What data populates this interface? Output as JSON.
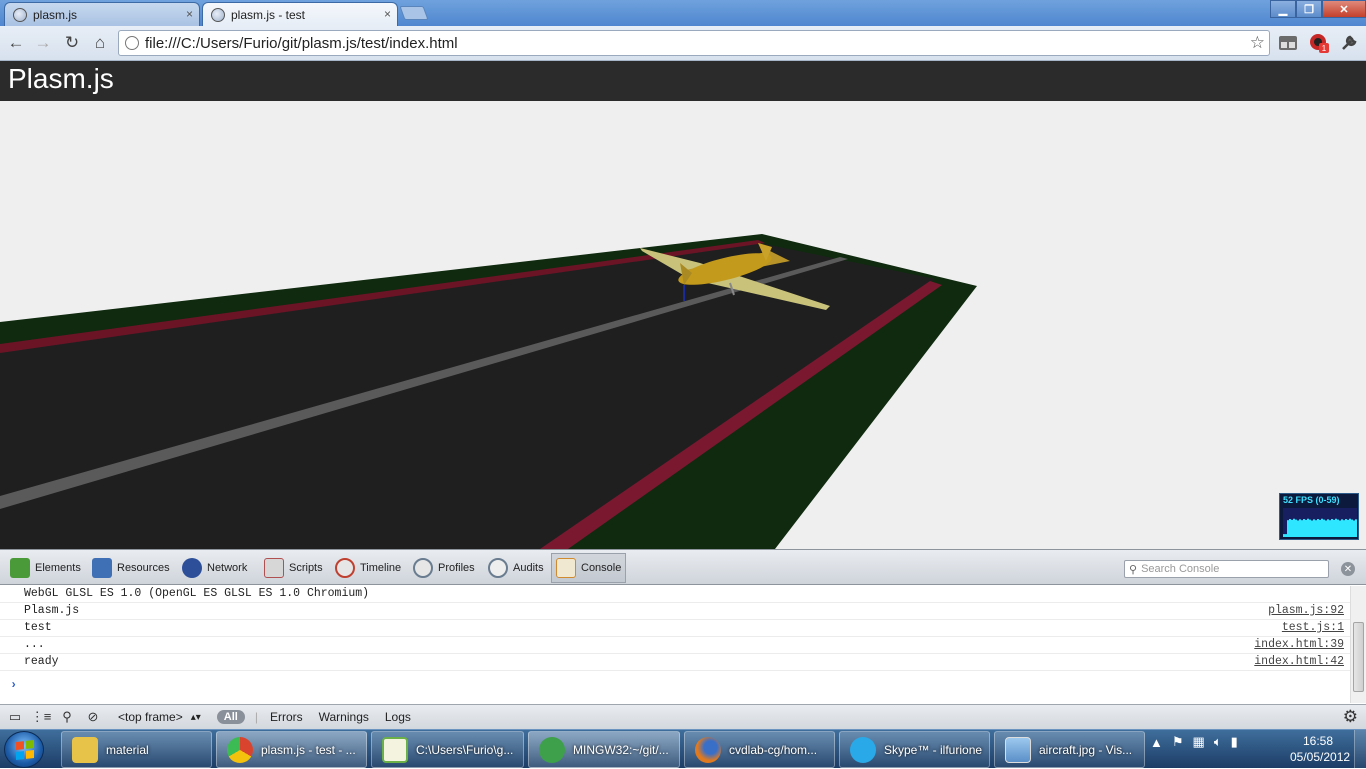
{
  "browser": {
    "tabs": [
      {
        "title": "plasm.js",
        "active": false
      },
      {
        "title": "plasm.js - test",
        "active": true
      }
    ],
    "tab_close_glyph": "×",
    "new_tab_icon": "new-tab-icon",
    "window_controls": {
      "minimize": "▁",
      "maximize": "❐",
      "close": "✕"
    },
    "nav": {
      "back": "←",
      "forward": "→",
      "reload": "↻",
      "home": "⌂"
    },
    "url": "file:///C:/Users/Furio/git/plasm.js/test/index.html",
    "star_glyph": "☆",
    "extension_badge": "1"
  },
  "page": {
    "title": "Plasm.js",
    "fps_label": "52 FPS (0-59)",
    "fps_level": 0.6
  },
  "devtools": {
    "tabs": [
      {
        "label": "Elements",
        "icon": "elements-icon",
        "color": "#4a9a3a"
      },
      {
        "label": "Resources",
        "icon": "resources-icon",
        "color": "#3f6fb5"
      },
      {
        "label": "Network",
        "icon": "network-icon",
        "color": "#2d4f99"
      },
      {
        "label": "Scripts",
        "icon": "scripts-icon",
        "color": "#b05050"
      },
      {
        "label": "Timeline",
        "icon": "timeline-icon",
        "color": "#c04030"
      },
      {
        "label": "Profiles",
        "icon": "profiles-icon",
        "color": "#6a7c90"
      },
      {
        "label": "Audits",
        "icon": "audits-icon",
        "color": "#6a7c90"
      },
      {
        "label": "Console",
        "icon": "console-icon",
        "color": "#d08a30",
        "selected": true
      }
    ],
    "search_placeholder": "Search Console",
    "console_rows": [
      {
        "message": "WebGL GLSL ES 1.0 (OpenGL ES GLSL ES 1.0 Chromium)",
        "source": ""
      },
      {
        "message": "Plasm.js",
        "source": "plasm.js:92"
      },
      {
        "message": "test",
        "source": "test.js:1"
      },
      {
        "message": "...",
        "source": "index.html:39"
      },
      {
        "message": "ready",
        "source": "index.html:42"
      }
    ],
    "prompt_glyph": "›",
    "status": {
      "frame": "<top frame>",
      "filters": [
        "All",
        "Errors",
        "Warnings",
        "Logs"
      ]
    }
  },
  "taskbar": {
    "items": [
      {
        "label": "material",
        "icon": "folder-icon",
        "color": "#e8c34a"
      },
      {
        "label": "plasm.js - test - ...",
        "icon": "chrome-icon",
        "color": "#d9442f",
        "active": true
      },
      {
        "label": "C:\\Users\\Furio\\g...",
        "icon": "notepad-icon",
        "color": "#6cb04a"
      },
      {
        "label": "MINGW32:~/git/...",
        "icon": "git-icon",
        "color": "#3ea04a"
      },
      {
        "label": "cvdlab-cg/hom...",
        "icon": "firefox-icon",
        "color": "#e07a20"
      },
      {
        "label": "Skype™ - ilfurione",
        "icon": "skype-icon",
        "color": "#2aa9e8"
      },
      {
        "label": "aircraft.jpg - Vis...",
        "icon": "image-viewer-icon",
        "color": "#5a8fc8"
      }
    ],
    "clock_time": "16:58",
    "clock_date": "05/05/2012"
  }
}
